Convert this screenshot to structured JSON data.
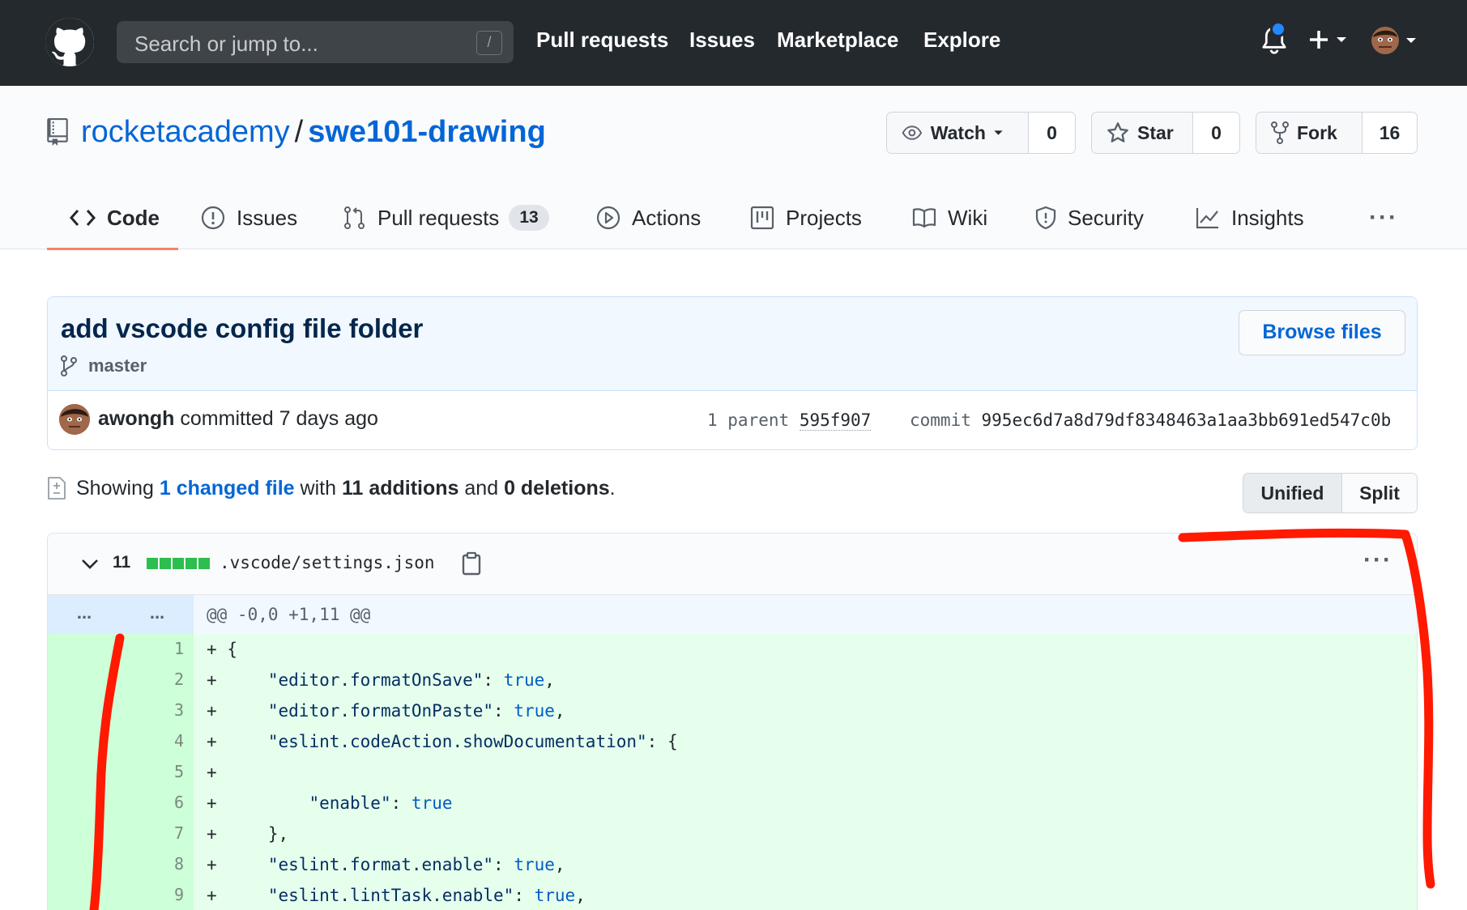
{
  "header": {
    "search_placeholder": "Search or jump to...",
    "search_shortcut": "/",
    "nav": [
      "Pull requests",
      "Issues",
      "Marketplace",
      "Explore"
    ]
  },
  "repo": {
    "owner": "rocketacademy",
    "separator": "/",
    "name": "swe101-drawing",
    "watch_label": "Watch",
    "watch_count": "0",
    "star_label": "Star",
    "star_count": "0",
    "fork_label": "Fork",
    "fork_count": "16"
  },
  "tabs": {
    "code": "Code",
    "issues": "Issues",
    "pull_requests": "Pull requests",
    "pull_requests_count": "13",
    "actions": "Actions",
    "projects": "Projects",
    "wiki": "Wiki",
    "security": "Security",
    "insights": "Insights",
    "more": "···"
  },
  "commit": {
    "title": "add vscode config file folder",
    "branch": "master",
    "browse_label": "Browse files",
    "author": "awongh",
    "committed_text": "committed 7 days ago",
    "parent_label": "1 parent",
    "parent_sha": "595f907",
    "commit_label": "commit",
    "commit_sha": "995ec6d7a8d79df8348463a1aa3bb691ed547c0b"
  },
  "toc": {
    "showing": "Showing",
    "changed_link": "1 changed file",
    "with": "with",
    "additions": "11 additions",
    "and": "and",
    "deletions": "0 deletions",
    "period": "."
  },
  "diff_view": {
    "unified_label": "Unified",
    "split_label": "Split"
  },
  "file": {
    "change_count": "11",
    "name": ".vscode/settings.json",
    "more": "···",
    "hunk_old": "...",
    "hunk_new": "...",
    "hunk_header": "@@ -0,0 +1,11 @@",
    "lines": [
      {
        "num": "1",
        "plus": "+",
        "indent": " ",
        "key": "",
        "mid": "{",
        "bool": "",
        "tail": ""
      },
      {
        "num": "2",
        "plus": "+",
        "indent": "     ",
        "key": "\"editor.formatOnSave\"",
        "mid": ": ",
        "bool": "true",
        "tail": ","
      },
      {
        "num": "3",
        "plus": "+",
        "indent": "     ",
        "key": "\"editor.formatOnPaste\"",
        "mid": ": ",
        "bool": "true",
        "tail": ","
      },
      {
        "num": "4",
        "plus": "+",
        "indent": "     ",
        "key": "\"eslint.codeAction.showDocumentation\"",
        "mid": ": {",
        "bool": "",
        "tail": ""
      },
      {
        "num": "5",
        "plus": "+",
        "indent": "",
        "key": "",
        "mid": "",
        "bool": "",
        "tail": ""
      },
      {
        "num": "6",
        "plus": "+",
        "indent": "         ",
        "key": "\"enable\"",
        "mid": ": ",
        "bool": "true",
        "tail": ""
      },
      {
        "num": "7",
        "plus": "+",
        "indent": "     ",
        "key": "",
        "mid": "},",
        "bool": "",
        "tail": ""
      },
      {
        "num": "8",
        "plus": "+",
        "indent": "     ",
        "key": "\"eslint.format.enable\"",
        "mid": ": ",
        "bool": "true",
        "tail": ","
      },
      {
        "num": "9",
        "plus": "+",
        "indent": "     ",
        "key": "\"eslint.lintTask.enable\"",
        "mid": ": ",
        "bool": "true",
        "tail": ","
      }
    ]
  },
  "colors": {
    "header_bg": "#24292e",
    "link_blue": "#0366d6",
    "addition_bg": "#e6ffed",
    "addition_num_bg": "#cdffd8",
    "annotation_red": "#ff1a00"
  }
}
